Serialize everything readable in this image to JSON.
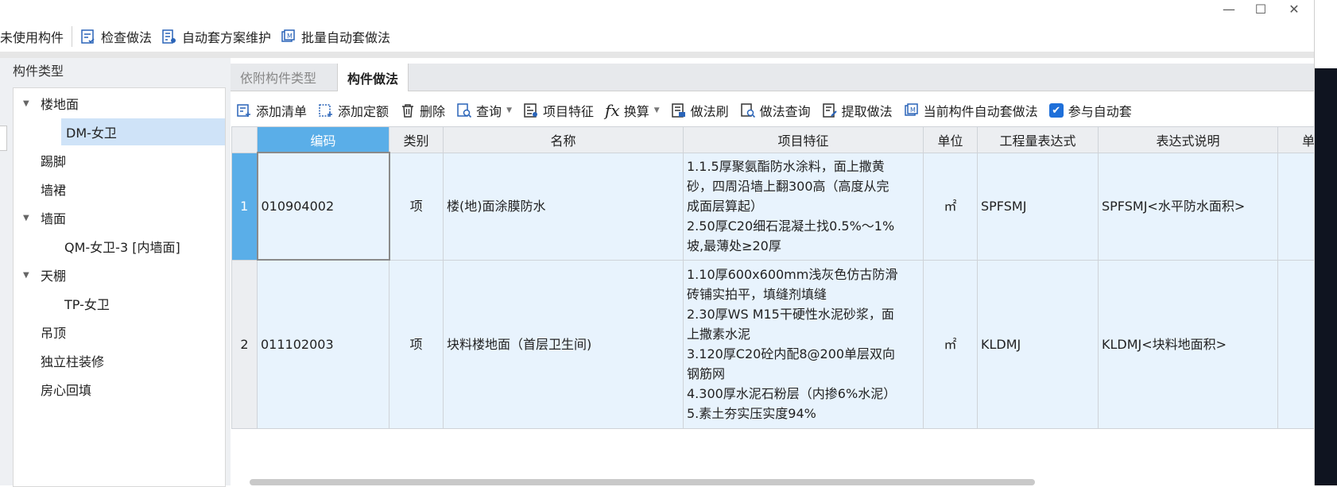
{
  "toolbar": {
    "items": [
      "未使用构件",
      "检查做法",
      "自动套方案维护",
      "批量自动套做法"
    ]
  },
  "left_panel": {
    "title": "构件类型",
    "tree": [
      {
        "label": "楼地面",
        "level": 0,
        "expanded": true
      },
      {
        "label": "DM-女卫",
        "level": 1,
        "selected": true
      },
      {
        "label": "踢脚",
        "level": 0
      },
      {
        "label": "墙裙",
        "level": 0
      },
      {
        "label": "墙面",
        "level": 0,
        "expanded": true
      },
      {
        "label": "QM-女卫-3 [内墙面]",
        "level": 1
      },
      {
        "label": "天棚",
        "level": 0,
        "expanded": true
      },
      {
        "label": "TP-女卫",
        "level": 1
      },
      {
        "label": "吊顶",
        "level": 0
      },
      {
        "label": "独立柱装修",
        "level": 0
      },
      {
        "label": "房心回填",
        "level": 0
      }
    ]
  },
  "tabs": [
    {
      "label": "依附构件类型",
      "active": false
    },
    {
      "label": "构件做法",
      "active": true
    }
  ],
  "subtoolbar": {
    "add_list": "添加清单",
    "add_quota": "添加定额",
    "delete": "删除",
    "query": "查询",
    "item_feature": "项目特征",
    "convert": "换算",
    "method_brush": "做法刷",
    "method_query": "做法查询",
    "extract_method": "提取做法",
    "auto_apply_current": "当前构件自动套做法",
    "participate_auto": "参与自动套",
    "participate_checked": true
  },
  "table": {
    "columns": [
      "编码",
      "类别",
      "名称",
      "项目特征",
      "单位",
      "工程量表达式",
      "表达式说明",
      "单"
    ],
    "rows": [
      {
        "num": "1",
        "code": "010904002",
        "category": "项",
        "name": "楼(地)面涂膜防水",
        "features": [
          "1.1.5厚聚氨酯防水涂料，面上撒黄",
          "砂，四周沿墙上翻300高（高度从完",
          "成面层算起）",
          "2.50厚C20细石混凝土找0.5%～1%",
          "坡,最薄处≥20厚"
        ],
        "unit": "㎡",
        "expr": "SPFSMJ",
        "expr_desc": "SPFSMJ<水平防水面积>"
      },
      {
        "num": "2",
        "code": "011102003",
        "category": "项",
        "name": "块料楼地面（首层卫生间)",
        "features": [
          "1.10厚600x600mm浅灰色仿古防滑",
          "砖铺实拍平，填缝剂填缝",
          "2.30厚WS M15干硬性水泥砂浆，面",
          "上撒素水泥",
          "3.120厚C20砼内配8@200单层双向",
          "钢筋网",
          "4.300厚水泥石粉层（内掺6%水泥）",
          "5.素土夯实压实度94%"
        ],
        "unit": "㎡",
        "expr": "KLDMJ",
        "expr_desc": "KLDMJ<块料地面积>"
      }
    ]
  },
  "colors": {
    "accent": "#5aaee8",
    "row_bg": "#e8f3fd",
    "selection": "#cfe3f8"
  }
}
